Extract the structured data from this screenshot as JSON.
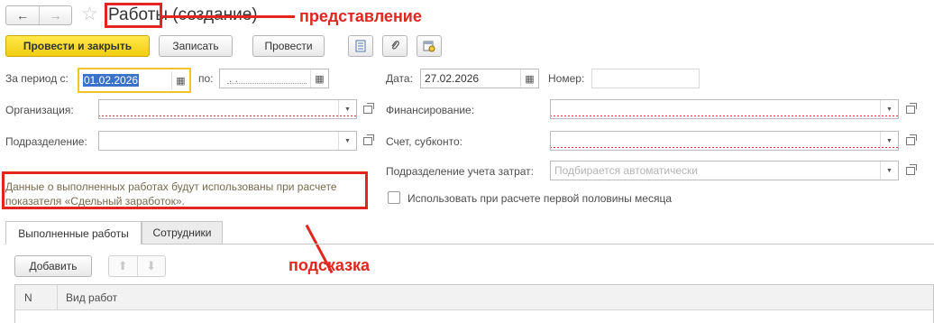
{
  "header": {
    "back_glyph": "←",
    "forward_glyph": "→",
    "title_main": "Работы",
    "title_suffix": " (создание)"
  },
  "annotations": {
    "presentation": "представление",
    "hint": "подсказка",
    "color": "#e2261f"
  },
  "toolbar": {
    "post_close": "Провести и закрыть",
    "save": "Записать",
    "post": "Провести",
    "icons": [
      "report-icon",
      "attachment-icon",
      "calendar-settings-icon"
    ]
  },
  "form": {
    "period_from_label": "За период с:",
    "period_from_value": "01.02.2026",
    "period_to_label": "по:",
    "period_to_value": " .  .",
    "date_label": "Дата:",
    "date_value": "27.02.2026",
    "number_label": "Номер:",
    "number_value": "",
    "organization_label": "Организация:",
    "financing_label": "Финансирование:",
    "department_label": "Подразделение:",
    "account_label": "Счет, субконто:",
    "cost_department_label": "Подразделение учета затрат:",
    "cost_department_placeholder": "Подбирается автоматически",
    "first_half_label": "Использовать при расчете первой половины месяца",
    "hint_text": "Данные о выполненных работах будут использованы при расчете показателя «Сдельный заработок»."
  },
  "tabs": [
    {
      "label": "Выполненные работы",
      "active": true
    },
    {
      "label": "Сотрудники",
      "active": false
    }
  ],
  "table": {
    "add_button": "Добавить",
    "columns": [
      "N",
      "Вид работ"
    ]
  },
  "colors": {
    "primary_button": "#f2cd12",
    "selection": "#3a72c9",
    "focus_border": "#f0c52c",
    "required_underline": "#d93030"
  }
}
